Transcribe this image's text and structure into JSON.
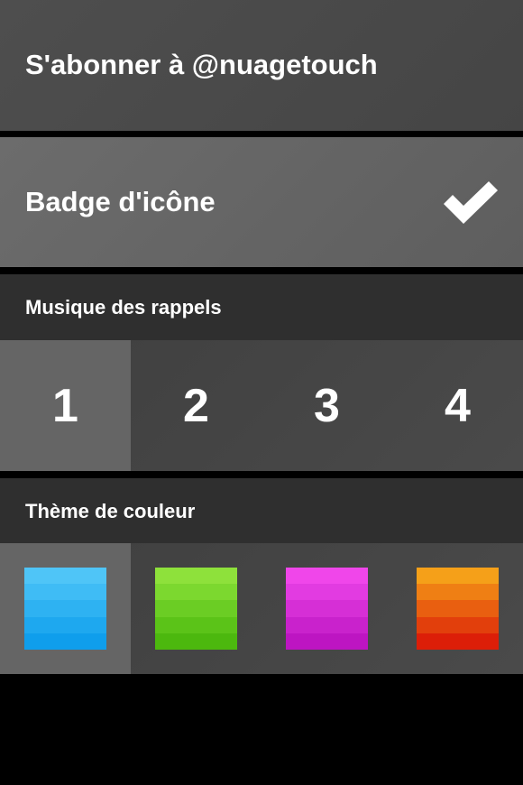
{
  "settings": {
    "follow_label": "S'abonner à @nuagetouch",
    "badge_label": "Badge d'icône",
    "badge_enabled": true
  },
  "music": {
    "header": "Musique des rappels",
    "options": [
      "1",
      "2",
      "3",
      "4"
    ],
    "selected": "1"
  },
  "theme": {
    "header": "Thème de couleur",
    "selected": "blue",
    "swatches": [
      {
        "name": "blue",
        "colors": [
          "#4fc5f7",
          "#3fbcf5",
          "#2eb2f2",
          "#1ea8ef",
          "#0f9eec"
        ]
      },
      {
        "name": "green",
        "colors": [
          "#8ee13b",
          "#7cd82f",
          "#6bcd24",
          "#5bc318",
          "#4cb80e"
        ]
      },
      {
        "name": "pink",
        "colors": [
          "#f046ea",
          "#e23be1",
          "#d62fd6",
          "#c922cc",
          "#bd15c2"
        ]
      },
      {
        "name": "orange",
        "colors": [
          "#f5a019",
          "#ef7f14",
          "#e95f10",
          "#e23f0c",
          "#dc1e08"
        ]
      }
    ]
  }
}
